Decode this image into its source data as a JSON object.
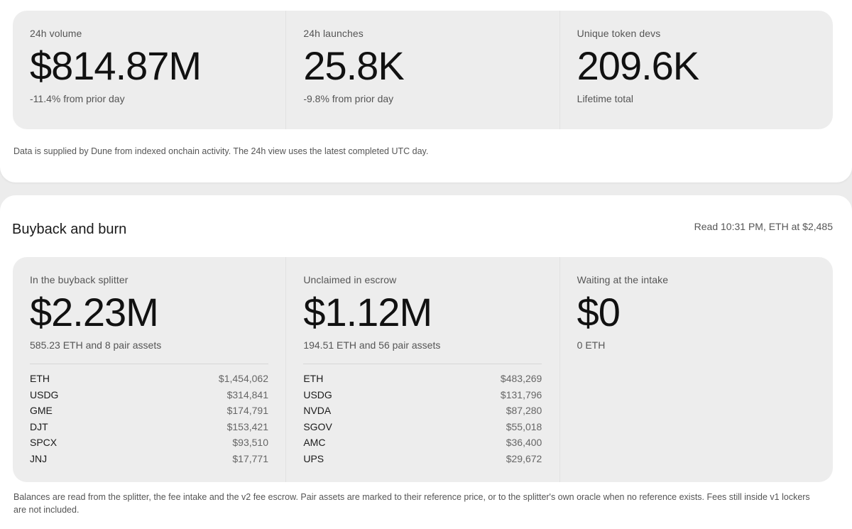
{
  "overview": {
    "stats": [
      {
        "label": "24h volume",
        "value": "$814.87M",
        "sub": "-11.4% from prior day"
      },
      {
        "label": "24h launches",
        "value": "25.8K",
        "sub": "-9.8% from prior day"
      },
      {
        "label": "Unique token devs",
        "value": "209.6K",
        "sub": "Lifetime total"
      }
    ],
    "note": "Data is supplied by Dune from indexed onchain activity. The 24h view uses the latest completed UTC day."
  },
  "buyback": {
    "title": "Buyback and burn",
    "read_time": "Read 10:31 PM, ETH at $2,485",
    "columns": [
      {
        "label": "In the buyback splitter",
        "value": "$2.23M",
        "sub": "585.23 ETH and 8 pair assets",
        "assets": [
          {
            "name": "ETH",
            "amount": "$1,454,062"
          },
          {
            "name": "USDG",
            "amount": "$314,841"
          },
          {
            "name": "GME",
            "amount": "$174,791"
          },
          {
            "name": "DJT",
            "amount": "$153,421"
          },
          {
            "name": "SPCX",
            "amount": "$93,510"
          },
          {
            "name": "JNJ",
            "amount": "$17,771"
          }
        ]
      },
      {
        "label": "Unclaimed in escrow",
        "value": "$1.12M",
        "sub": "194.51 ETH and 56 pair assets",
        "assets": [
          {
            "name": "ETH",
            "amount": "$483,269"
          },
          {
            "name": "USDG",
            "amount": "$131,796"
          },
          {
            "name": "NVDA",
            "amount": "$87,280"
          },
          {
            "name": "SGOV",
            "amount": "$55,018"
          },
          {
            "name": "AMC",
            "amount": "$36,400"
          },
          {
            "name": "UPS",
            "amount": "$29,672"
          }
        ]
      },
      {
        "label": "Waiting at the intake",
        "value": "$0",
        "sub": "0 ETH",
        "assets": []
      }
    ],
    "note": "Balances are read from the splitter, the fee intake and the v2 fee escrow. Pair assets are marked to their reference price, or to the splitter's own oracle when no reference exists. Fees still inside v1 lockers are not included."
  }
}
